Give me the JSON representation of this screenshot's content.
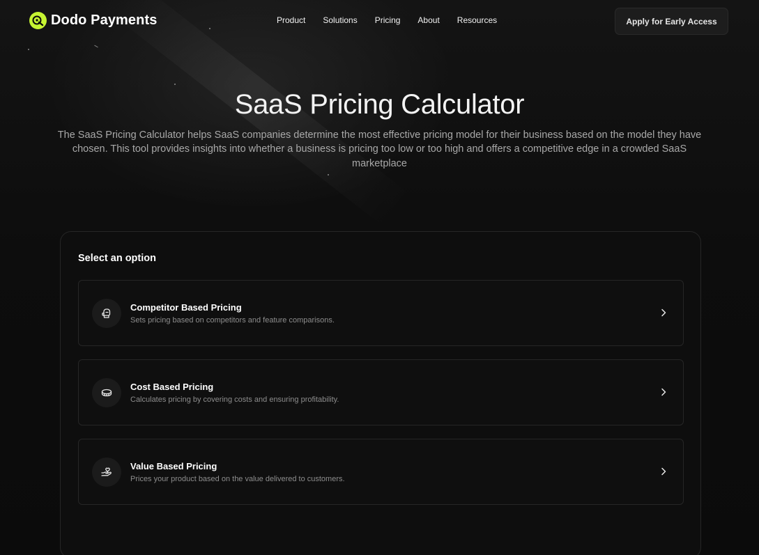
{
  "brand": {
    "name": "Dodo Payments",
    "accent": "#c6f432"
  },
  "nav": {
    "links": [
      "Product",
      "Solutions",
      "Pricing",
      "About",
      "Resources"
    ],
    "cta_label": "Apply for Early Access"
  },
  "hero": {
    "title": "SaaS Pricing Calculator",
    "description": "The SaaS Pricing Calculator helps SaaS companies determine the most effective pricing model for their business based on the model they have chosen. This tool provides insights into whether a business is pricing too low or too high and offers a competitive edge in a crowded SaaS marketplace"
  },
  "options_card": {
    "title": "Select an option",
    "options": [
      {
        "icon": "boxing-glove-icon",
        "title": "Competitor Based Pricing",
        "description": "Sets pricing based on competitors and feature comparisons."
      },
      {
        "icon": "coins-icon",
        "title": "Cost Based Pricing",
        "description": "Calculates pricing by covering costs and ensuring profitability."
      },
      {
        "icon": "hand-heart-icon",
        "title": "Value Based Pricing",
        "description": "Prices your product based on the value delivered to customers."
      }
    ]
  }
}
